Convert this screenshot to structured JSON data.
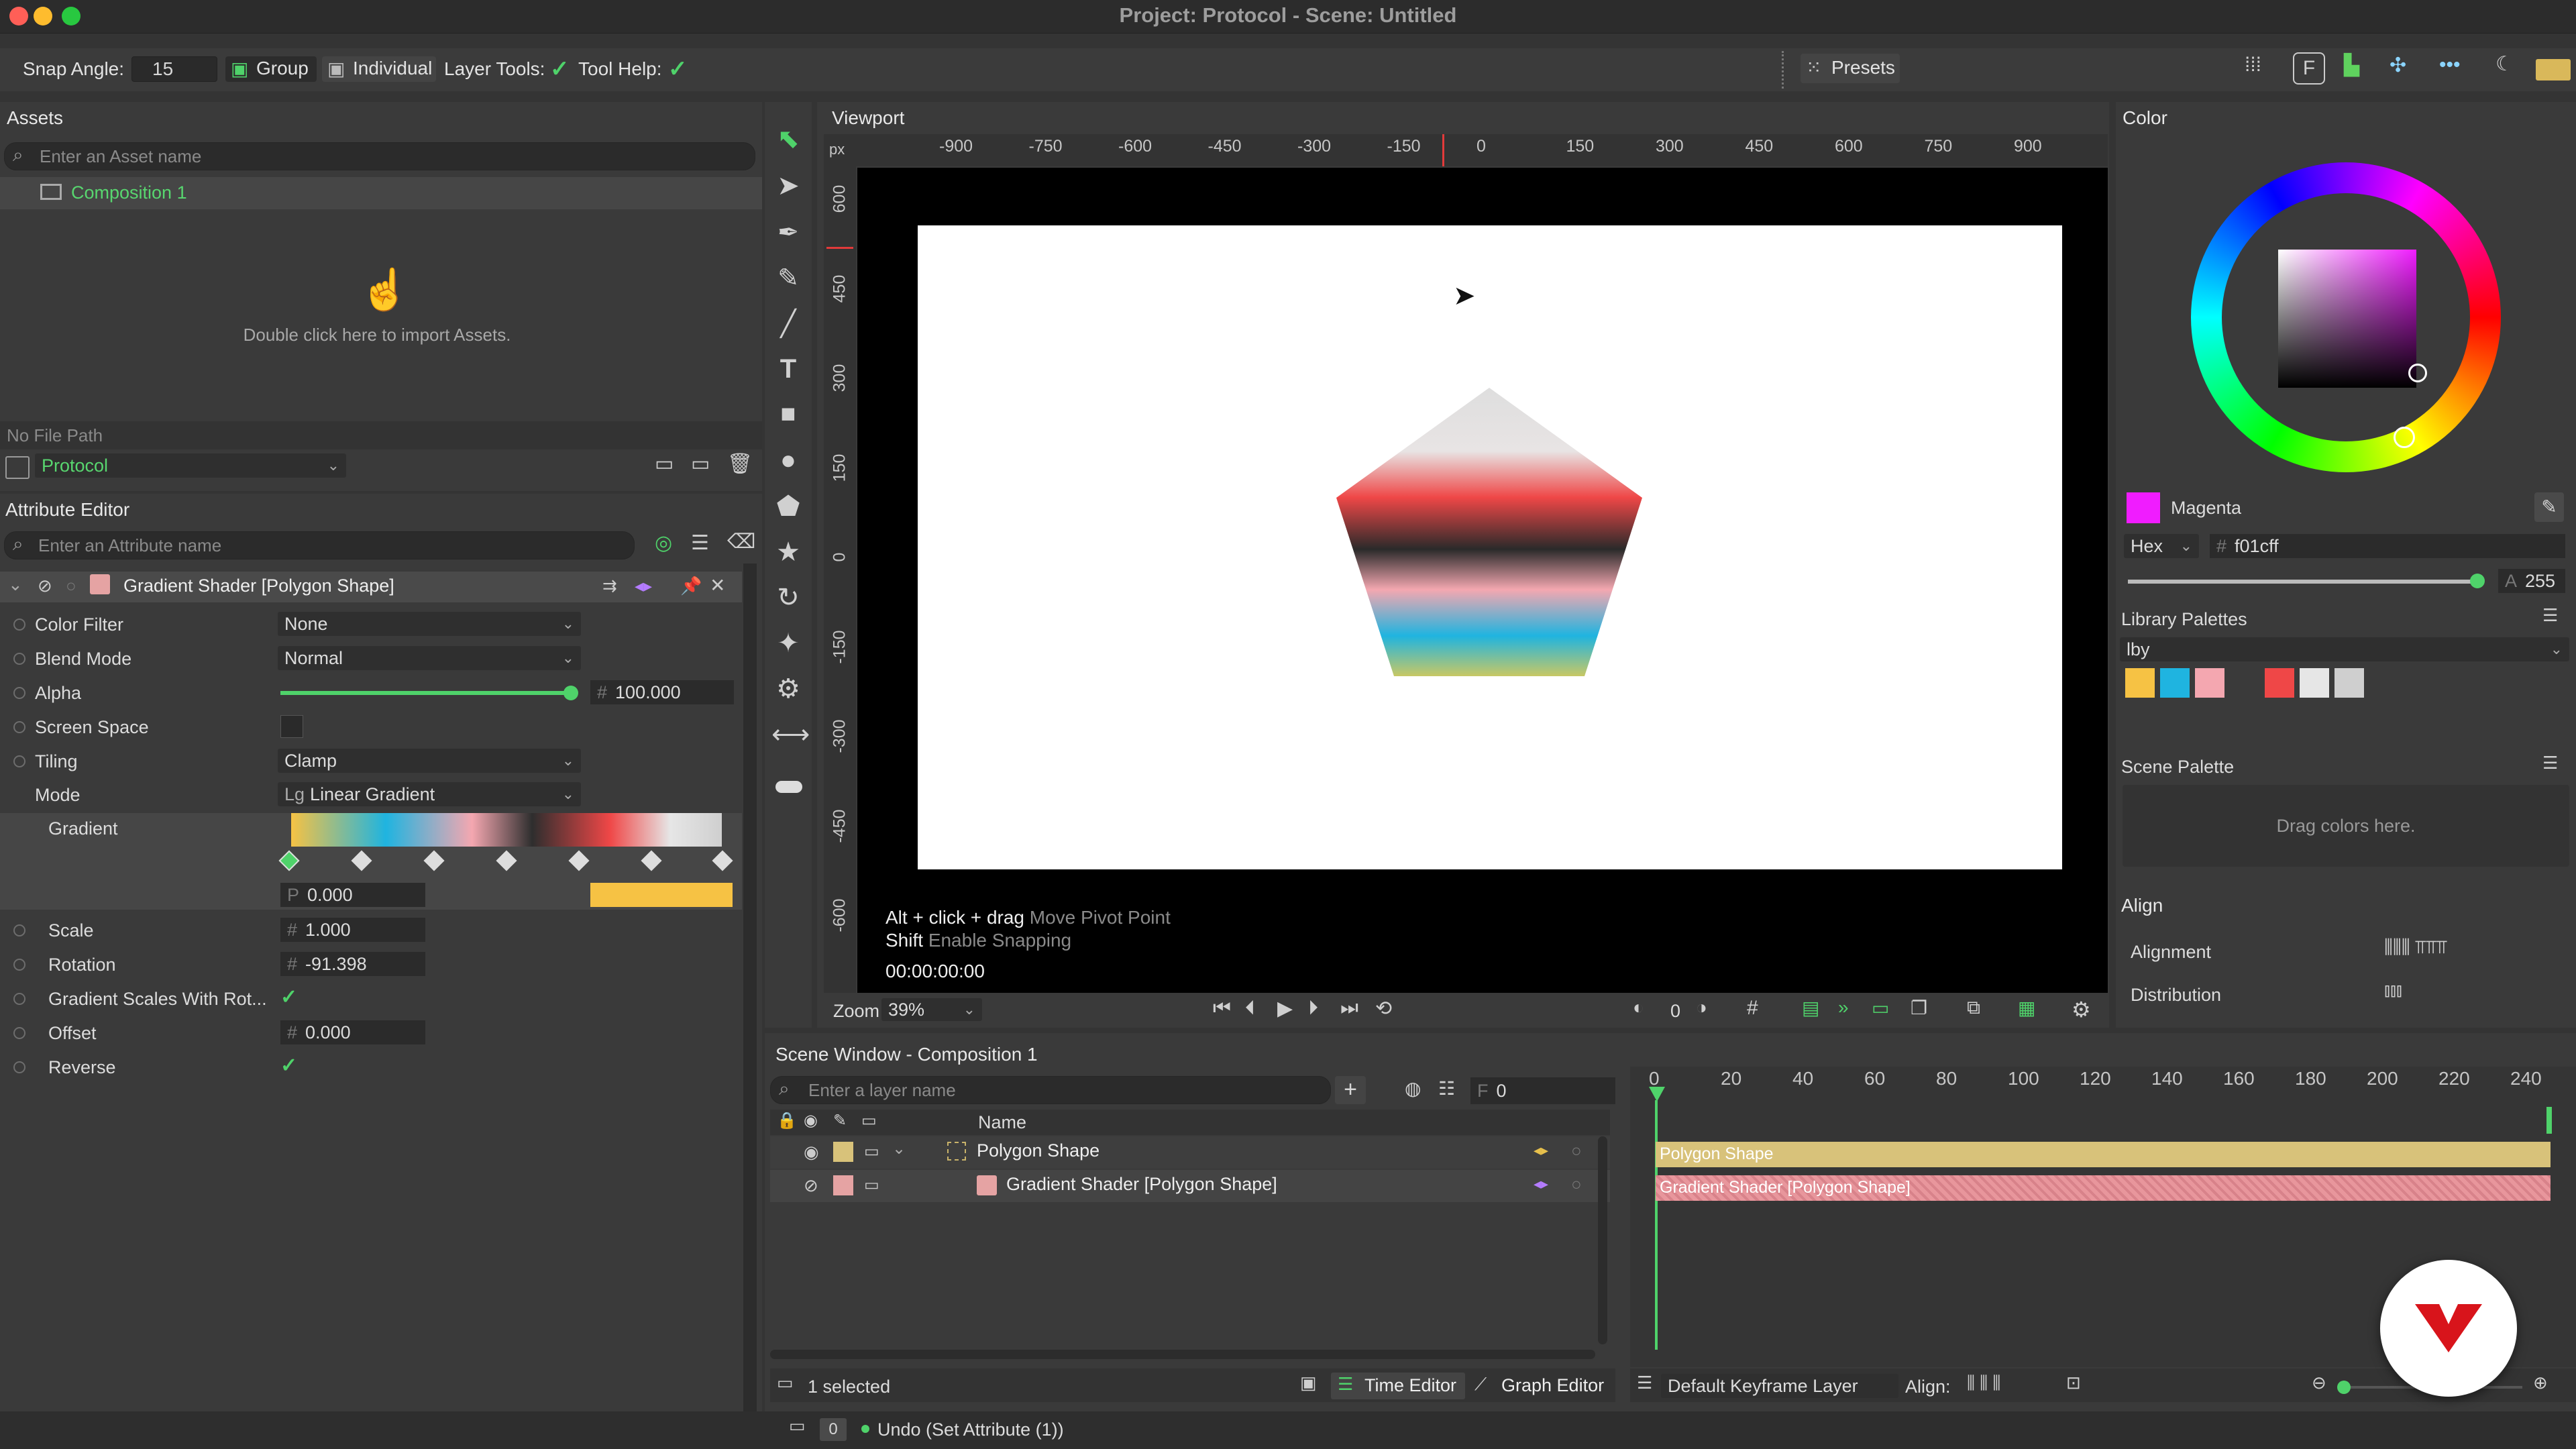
{
  "window": {
    "title": "Project: Protocol - Scene: Untitled"
  },
  "toolbar": {
    "snap_angle_label": "Snap Angle:",
    "snap_angle_value": "15",
    "group_label": "Group",
    "individual_label": "Individual",
    "layer_tools_label": "Layer Tools:",
    "tool_help_label": "Tool Help:",
    "presets_label": "Presets"
  },
  "assets": {
    "title": "Assets",
    "search_placeholder": "Enter an Asset name",
    "items": [
      "Composition 1"
    ],
    "import_hint": "Double click here to import Assets.",
    "file_path": "No File Path",
    "project_select": "Protocol"
  },
  "attribute_editor": {
    "title": "Attribute Editor",
    "search_placeholder": "Enter an Attribute name",
    "node_title": "Gradient Shader [Polygon Shape]",
    "rows": {
      "color_filter": {
        "label": "Color Filter",
        "value": "None"
      },
      "blend_mode": {
        "label": "Blend Mode",
        "value": "Normal"
      },
      "alpha": {
        "label": "Alpha",
        "value": "100.000",
        "fraction": 1.0
      },
      "screen_space": {
        "label": "Screen Space"
      },
      "tiling": {
        "label": "Tiling",
        "value": "Clamp"
      },
      "mode": {
        "label": "Mode",
        "prefix": "Lg",
        "value": "Linear Gradient"
      },
      "gradient": {
        "label": "Gradient",
        "position_prefix": "P",
        "position": "0.000",
        "stop_color": "#f6c244"
      },
      "scale": {
        "label": "Scale",
        "value": "1.000"
      },
      "rotation": {
        "label": "Rotation",
        "value": "-91.398"
      },
      "gradient_scales": {
        "label": "Gradient Scales With Rot..."
      },
      "offset": {
        "label": "Offset",
        "value": "0.000"
      },
      "reverse": {
        "label": "Reverse"
      }
    }
  },
  "viewport": {
    "title": "Viewport",
    "ruler_unit": "px",
    "h_ticks": [
      "-900",
      "-750",
      "-600",
      "-450",
      "-300",
      "-150",
      "0",
      "150",
      "300",
      "450",
      "600",
      "750",
      "900"
    ],
    "v_ticks": [
      "600",
      "450",
      "300",
      "150",
      "0",
      "-150",
      "-300",
      "-450",
      "-600"
    ],
    "hint1_key": "Alt + click + drag",
    "hint1_text": "Move Pivot Point",
    "hint2_key": "Shift",
    "hint2_text": "Enable Snapping",
    "timecode": "00:00:00:00",
    "zoom_label": "Zoom",
    "zoom_value": "39%",
    "frame_value": "0"
  },
  "color": {
    "title": "Color",
    "name": "Magenta",
    "swatch": "#f01cff",
    "format": "Hex",
    "hex_value": "f01cff",
    "alpha_value": "255",
    "library_title": "Library Palettes",
    "library_select": "lby",
    "library_swatches": [
      "#f6c244",
      "#1fb4e0",
      "#f4a7b0",
      "#3a3a3a",
      "#ef4747",
      "#e6e6e6",
      "#cfcfcf"
    ],
    "scene_palette_title": "Scene Palette",
    "scene_palette_hint": "Drag colors here."
  },
  "align_panel": {
    "title": "Align",
    "alignment_label": "Alignment",
    "distribution_label": "Distribution"
  },
  "scene_window": {
    "title": "Scene Window - Composition 1",
    "search_placeholder": "Enter a layer name",
    "frame_prefix": "F",
    "frame_value": "0",
    "name_header": "Name",
    "layers": [
      {
        "name": "Polygon Shape",
        "color": "#d8c27a"
      },
      {
        "name": "Gradient Shader [Polygon Shape]",
        "color": "#e5a3a3"
      }
    ],
    "status": "1 selected",
    "time_editor_label": "Time Editor",
    "graph_editor_label": "Graph Editor"
  },
  "timeline": {
    "ticks": [
      "0",
      "20",
      "40",
      "60",
      "80",
      "100",
      "120",
      "140",
      "160",
      "180",
      "200",
      "220",
      "240"
    ],
    "tracks": [
      {
        "label": "Polygon Shape",
        "color": "#d8c27a"
      },
      {
        "label": "Gradient Shader [Polygon Shape]",
        "color": "#e8969c"
      }
    ],
    "keyframe_layer": "Default Keyframe Layer",
    "align_label": "Align:"
  },
  "statusbar": {
    "undo_count": "0",
    "undo_text": "Undo (Set Attribute (1))"
  }
}
